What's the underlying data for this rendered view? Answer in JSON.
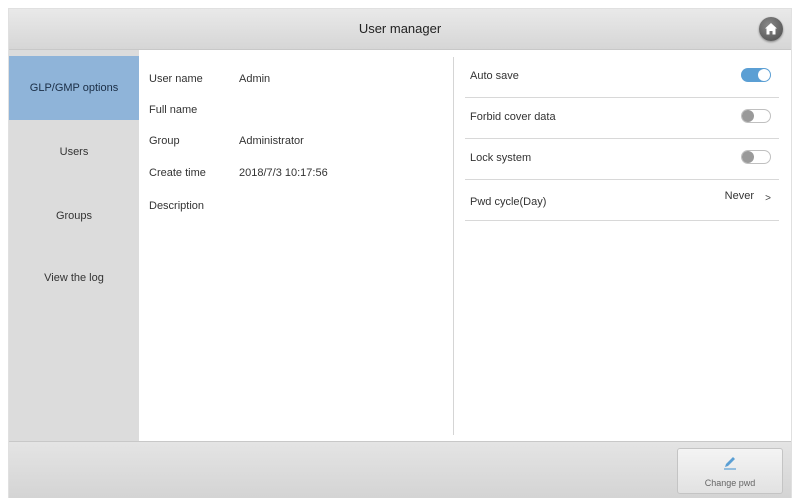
{
  "window": {
    "title": "User manager"
  },
  "icons": {
    "home": "home-icon",
    "change_pwd": "edit-pen-icon"
  },
  "colors": {
    "active_tab": "#8fb4d9",
    "toggle_on": "#5b9fd4"
  },
  "sidebar": {
    "items": [
      {
        "label": "GLP/GMP options",
        "active": true
      },
      {
        "label": "Users",
        "active": false
      },
      {
        "label": "Groups",
        "active": false
      },
      {
        "label": "View the log",
        "active": false
      }
    ]
  },
  "user_info": {
    "user_name": {
      "label": "User name",
      "value": "Admin"
    },
    "full_name": {
      "label": "Full name",
      "value": ""
    },
    "group": {
      "label": "Group",
      "value": "Administrator"
    },
    "create_time": {
      "label": "Create time",
      "value": "2018/7/3 10:17:56"
    },
    "description": {
      "label": "Description",
      "value": ""
    }
  },
  "settings": {
    "auto_save": {
      "label": "Auto save",
      "on": true
    },
    "forbid_cover": {
      "label": "Forbid cover data",
      "on": false
    },
    "lock_system": {
      "label": "Lock system",
      "on": false
    },
    "pwd_cycle": {
      "label": "Pwd cycle(Day)",
      "value": "Never",
      "arrow": ">"
    }
  },
  "footer": {
    "change_pwd_label": "Change pwd"
  }
}
